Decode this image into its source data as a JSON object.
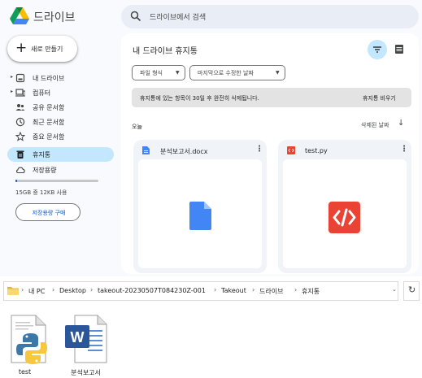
{
  "app": {
    "title": "드라이브",
    "logo_icon": "google-drive-logo"
  },
  "search": {
    "placeholder": "드라이브에서 검색"
  },
  "new_button": {
    "label": "새로 만들기"
  },
  "sidebar": {
    "items": [
      {
        "label": "내 드라이브",
        "icon": "my-drive-icon",
        "expandable": true
      },
      {
        "label": "컴퓨터",
        "icon": "computer-icon",
        "expandable": true
      },
      {
        "label": "공유 문서함",
        "icon": "shared-icon"
      },
      {
        "label": "최근 문서함",
        "icon": "clock-icon"
      },
      {
        "label": "중요 문서함",
        "icon": "star-icon"
      },
      {
        "label": "휴지통",
        "icon": "trash-icon",
        "active": true
      },
      {
        "label": "저장용량",
        "icon": "cloud-icon"
      }
    ],
    "storage_text": "15GB 중 12KB 사용",
    "storage_used_fraction": 0.01,
    "buy_storage_label": "저장용량 구매"
  },
  "main": {
    "title": "내 드라이브 휴지통",
    "filters": [
      {
        "label": "파일 형식"
      },
      {
        "label": "마지막으로 수정한 날짜"
      }
    ],
    "banner": {
      "text": "휴지통에 있는 항목이 30일 후 완전히 삭제됩니다.",
      "action": "휴지통 비우기"
    },
    "section_label": "오늘",
    "sort_label": "삭제된 날짜",
    "files": [
      {
        "name": "분석보고서.docx",
        "type_icon": "google-docs-icon",
        "color": "#4285f4"
      },
      {
        "name": "test.py",
        "type_icon": "code-icon",
        "color": "#ea4335"
      }
    ]
  },
  "explorer": {
    "breadcrumbs": [
      "내 PC",
      "Desktop",
      "takeout-20230507T084230Z-001",
      "Takeout",
      "드라이브",
      "휴지통"
    ],
    "files": [
      {
        "label": "test",
        "icon": "python-file-icon"
      },
      {
        "label": "분석보고서",
        "icon": "word-file-icon"
      }
    ]
  },
  "colors": {
    "accent": "#0b57d0",
    "active_nav": "#c2e7ff",
    "background": "#f8fafd"
  }
}
